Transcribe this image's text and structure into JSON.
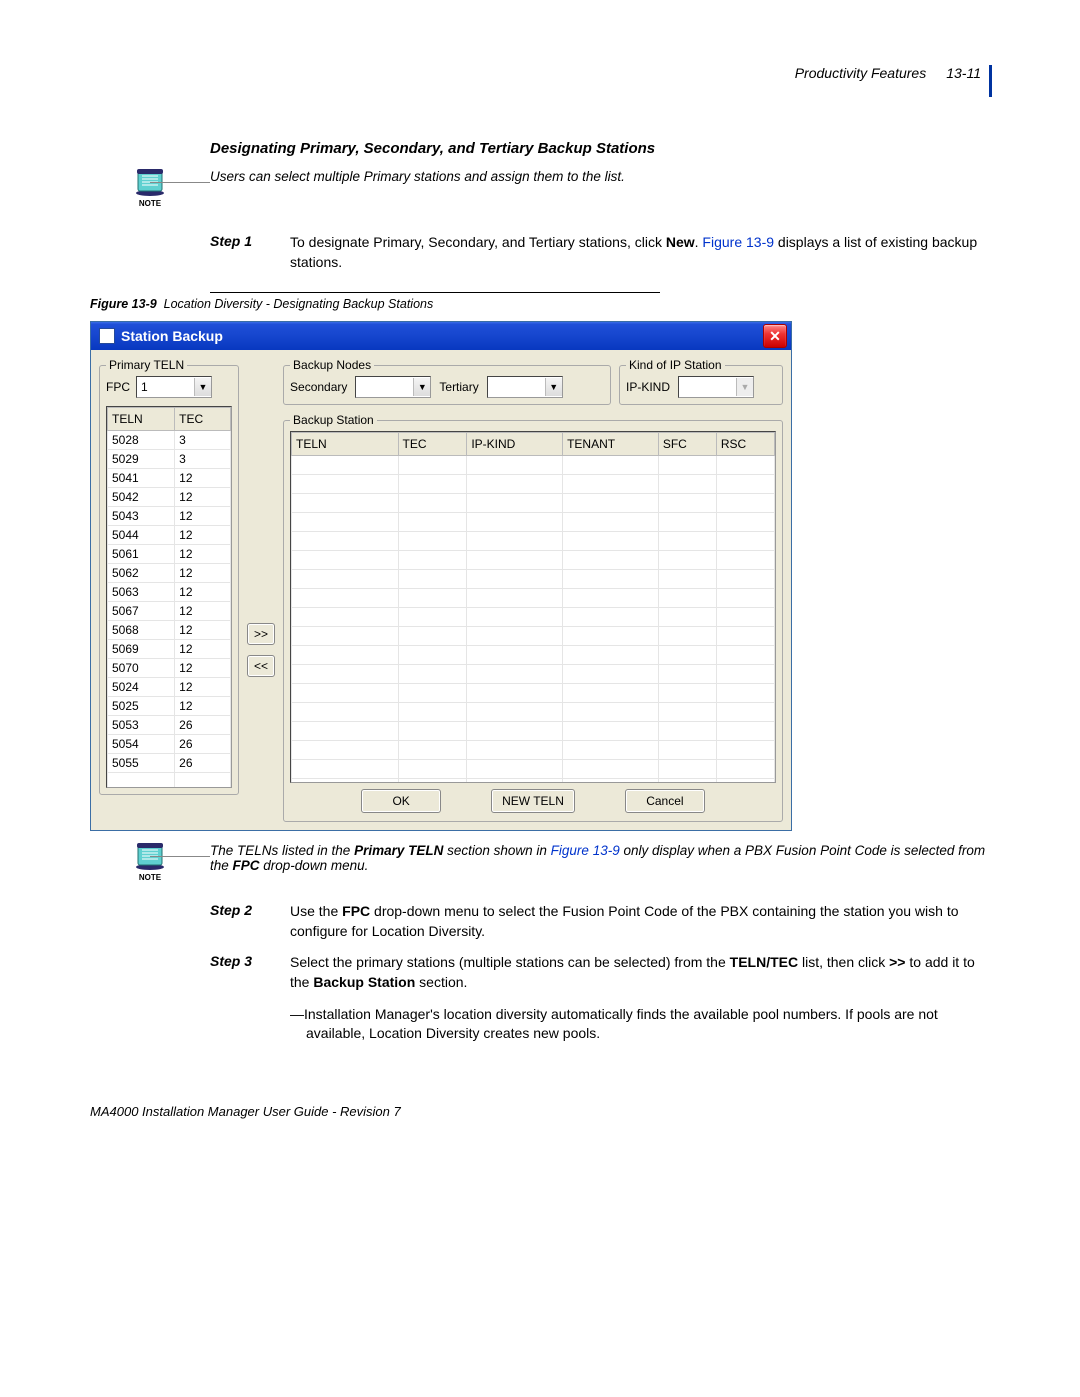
{
  "header": {
    "section": "Productivity Features",
    "page_num": "13-11"
  },
  "section_title": "Designating Primary, Secondary, and Tertiary Backup Stations",
  "note1": "Users can select multiple Primary stations and assign them to the list.",
  "note_label": "NOTE",
  "step1": {
    "label": "Step 1",
    "text_a": "To designate Primary, Secondary, and Tertiary stations, click ",
    "bold": "New",
    "text_b": ". ",
    "link": "Figure 13-9",
    "text_c": " displays a list of existing backup stations."
  },
  "fig_caption": {
    "number": "Figure 13-9",
    "title": "Location Diversity - Designating Backup Stations"
  },
  "dialog": {
    "title": "Station Backup",
    "groups": {
      "primary_teln": "Primary TELN",
      "backup_nodes": "Backup Nodes",
      "kind_ip": "Kind of IP Station",
      "backup_station": "Backup Station"
    },
    "labels": {
      "fpc": "FPC",
      "secondary": "Secondary",
      "tertiary": "Tertiary",
      "ipkind": "IP-KIND"
    },
    "fpc_value": "1",
    "primary_cols": [
      "TELN",
      "TEC"
    ],
    "primary_rows": [
      [
        "5028",
        "3"
      ],
      [
        "5029",
        "3"
      ],
      [
        "5041",
        "12"
      ],
      [
        "5042",
        "12"
      ],
      [
        "5043",
        "12"
      ],
      [
        "5044",
        "12"
      ],
      [
        "5061",
        "12"
      ],
      [
        "5062",
        "12"
      ],
      [
        "5063",
        "12"
      ],
      [
        "5067",
        "12"
      ],
      [
        "5068",
        "12"
      ],
      [
        "5069",
        "12"
      ],
      [
        "5070",
        "12"
      ],
      [
        "5024",
        "12"
      ],
      [
        "5025",
        "12"
      ],
      [
        "5053",
        "26"
      ],
      [
        "5054",
        "26"
      ],
      [
        "5055",
        "26"
      ]
    ],
    "backup_cols": [
      "TELN",
      "TEC",
      "IP-KIND",
      "TENANT",
      "SFC",
      "RSC"
    ],
    "buttons": {
      "add": ">>",
      "remove": "<<",
      "ok": "OK",
      "new": "NEW TELN",
      "cancel": "Cancel"
    }
  },
  "note2": {
    "a": "The TELNs listed in the ",
    "b1": "Primary TELN",
    "c": " section shown in ",
    "link": "Figure 13-9",
    "d": " only display when a PBX Fusion Point Code is selected from the ",
    "b2": "FPC",
    "e": " drop-down menu."
  },
  "step2": {
    "label": "Step 2",
    "a": "Use the ",
    "b": "FPC",
    "c": " drop-down menu to select the Fusion Point Code of the PBX containing the station you wish to configure for Location Diversity."
  },
  "step3": {
    "label": "Step 3",
    "a": "Select the primary stations (multiple stations can be selected) from the ",
    "b1": "TELN/TEC",
    "c": " list, then click ",
    "b2": ">>",
    "d": " to add it to the ",
    "b3": "Backup Station",
    "e": " section."
  },
  "sub_bullet": "—Installation Manager's location diversity automatically finds the available pool numbers. If pools are not available, Location Diversity creates new pools.",
  "footer": "MA4000 Installation Manager User Guide - Revision 7"
}
